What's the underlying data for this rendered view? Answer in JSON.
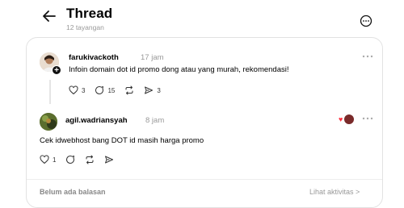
{
  "header": {
    "title": "Thread",
    "subtitle": "12 tayangan"
  },
  "post": {
    "username": "farukivackoth",
    "time": "17 jam",
    "text": "Infoin domain dot id promo dong atau yang murah, rekomendasi!",
    "likes": "3",
    "comments": "15",
    "shares": "3",
    "avatar_icon": "profile-photo",
    "follow_badge": "+"
  },
  "reply": {
    "username": "agil.wadriansyah",
    "time": "8 jam",
    "text": "Cek idwebhost bang DOT id masih harga promo",
    "likes": "1",
    "avatar_icon": "profile-photo",
    "liked_by_author_icon": "heart-icon"
  },
  "footer": {
    "no_replies": "Belum ada balasan",
    "view_activity": "Lihat aktivitas >"
  },
  "colors": {
    "heart": "#ff3040",
    "muted_text": "#999999",
    "border": "#e2e2e2"
  }
}
